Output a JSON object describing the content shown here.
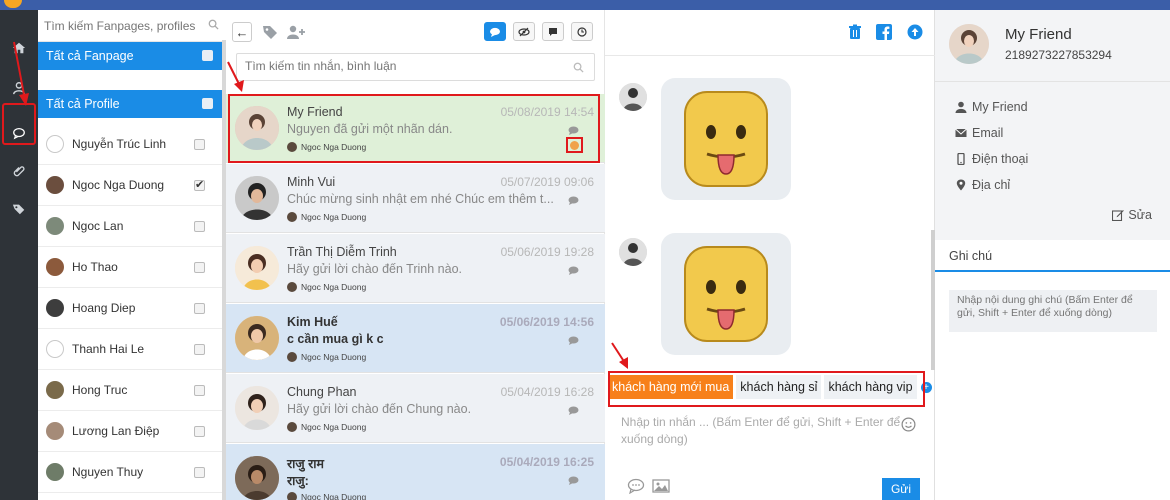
{
  "left_nav": {
    "icons": [
      "home-icon",
      "user-icon",
      "chat-icon",
      "tag-icon",
      "label-icon"
    ]
  },
  "pages_panel": {
    "search_placeholder": "Tìm kiếm Fanpages, profiles",
    "fanpage_group": "Tất cả Fanpage",
    "profile_group": "Tất cả Profile",
    "profiles": [
      {
        "name": "Nguyễn Trúc Linh",
        "checked": false
      },
      {
        "name": "Ngoc Nga Duong",
        "checked": true
      },
      {
        "name": "Ngoc Lan",
        "checked": false
      },
      {
        "name": "Ho Thao",
        "checked": false
      },
      {
        "name": "Hoang Diep",
        "checked": false
      },
      {
        "name": "Thanh Hai Le",
        "checked": false
      },
      {
        "name": "Hong Truc",
        "checked": false
      },
      {
        "name": "Lương Lan Điệp",
        "checked": false
      },
      {
        "name": "Nguyen Thuy",
        "checked": false
      }
    ]
  },
  "conversations": {
    "search_placeholder": "Tìm kiếm tin nhắn, bình luận",
    "items": [
      {
        "name": "My Friend",
        "date": "05/08/2019 14:54",
        "message": "Nguyen đã gửi một nhãn dán.",
        "agent": "Ngoc Nga Duong",
        "state": "selected"
      },
      {
        "name": "Minh Vui",
        "date": "05/07/2019 09:06",
        "message": "Chúc mừng sinh nhật em nhé Chúc em thêm t...",
        "agent": "Ngoc Nga Duong",
        "state": "read"
      },
      {
        "name": "Trần Thị Diễm Trinh",
        "date": "05/06/2019 19:28",
        "message": "Hãy gửi lời chào đến Trinh nào.",
        "agent": "Ngoc Nga Duong",
        "state": "read"
      },
      {
        "name": "Kim Huế",
        "date": "05/06/2019 14:56",
        "message": "c cần mua gì k c",
        "agent": "Ngoc Nga Duong",
        "state": "unread"
      },
      {
        "name": "Chung Phan",
        "date": "05/04/2019 16:28",
        "message": "Hãy gửi lời chào đến Chung nào.",
        "agent": "Ngoc Nga Duong",
        "state": "read"
      },
      {
        "name": "राजु राम",
        "date": "05/04/2019 16:25",
        "message": "राजु: ",
        "agent": "Ngoc Nga Duong",
        "state": "unread"
      }
    ]
  },
  "chat": {
    "tags": [
      "khách hàng mới mua",
      "khách hàng sỉ",
      "khách hàng vip"
    ],
    "input_placeholder": "Nhập tin nhắn ... (Bấm Enter để gửi, Shift + Enter để xuống dòng)",
    "send_label": "Gửi"
  },
  "profile": {
    "name": "My Friend",
    "id": "2189273227853294",
    "fields": {
      "name": "My Friend",
      "email": "Email",
      "phone": "Điện thoại",
      "address": "Địa chỉ"
    },
    "edit_label": "Sửa",
    "notes_tab": "Ghi chú",
    "notes_placeholder": "Nhập nội dung ghi chú (Bấm Enter để gửi, Shift + Enter để xuống dòng)"
  },
  "colors": {
    "accent": "#1a8ce6",
    "sidebar": "#2e3338",
    "highlight": "#e0191c",
    "active_tag": "#f7801a"
  }
}
